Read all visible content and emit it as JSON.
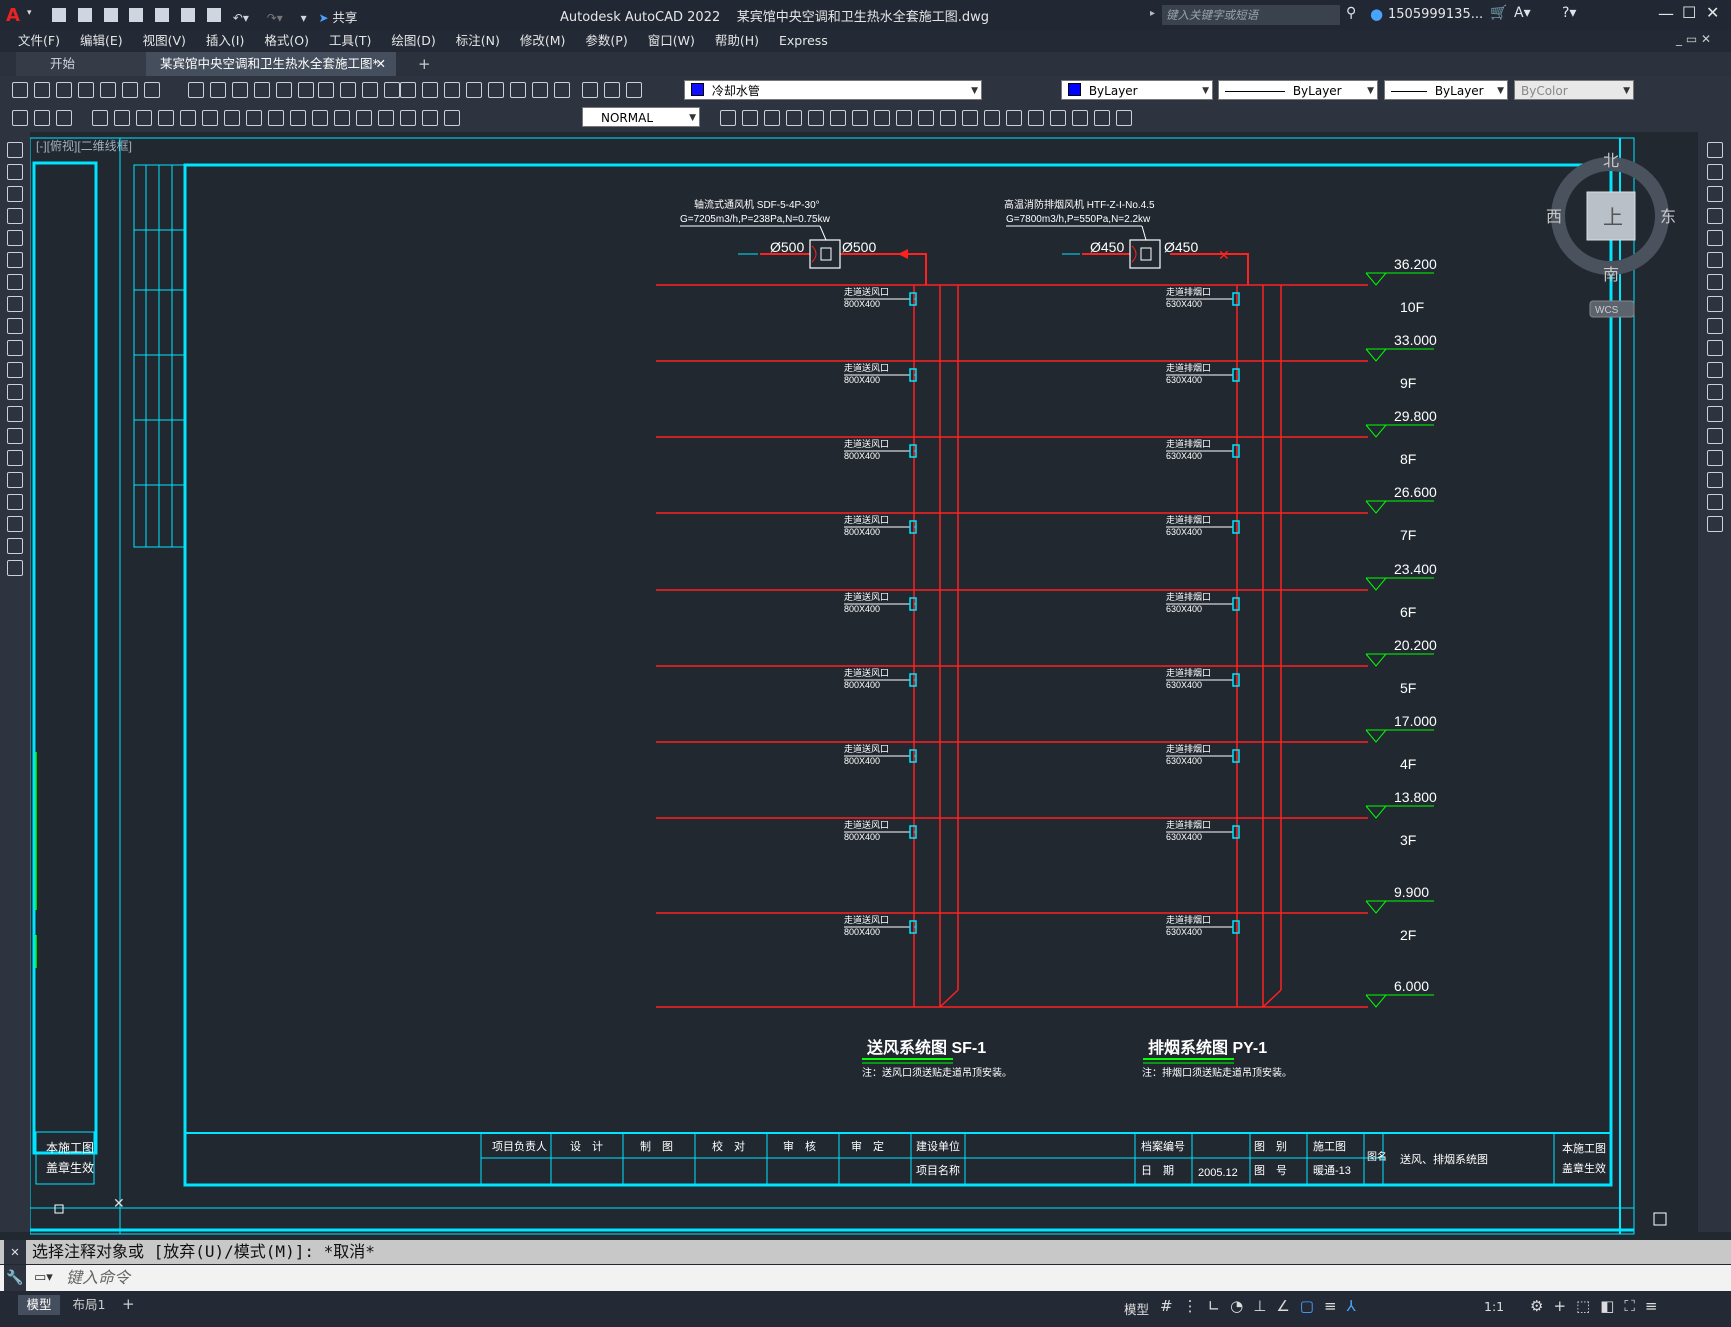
{
  "title": {
    "app": "Autodesk AutoCAD 2022",
    "file": "某宾馆中央空调和卫生热水全套施工图.dwg",
    "search_placeholder": "键入关键字或短语",
    "user": "1505999135...",
    "share": "共享"
  },
  "menu": [
    "文件(F)",
    "编辑(E)",
    "视图(V)",
    "插入(I)",
    "格式(O)",
    "工具(T)",
    "绘图(D)",
    "标注(N)",
    "修改(M)",
    "参数(P)",
    "窗口(W)",
    "帮助(H)",
    "Express"
  ],
  "tabs": {
    "start": "开始",
    "drawing": "某宾馆中央空调和卫生热水全套施工图*",
    "close": "✕",
    "add": "+"
  },
  "toolbar": {
    "layer_name": "冷却水管",
    "color": "ByLayer",
    "linetype": "ByLayer",
    "lineweight": "ByLayer",
    "plotstyle": "ByColor",
    "dimstyle": "NORMAL"
  },
  "viewport_label": "[-][俯视][二维线框]",
  "viewcube": {
    "n": "北",
    "s": "南",
    "e": "东",
    "w": "西",
    "top": "上",
    "wcs": "WCS"
  },
  "drawing": {
    "fan_left_label1": "轴流式通风机 SDF-5-4P-30°",
    "fan_left_label2": "G=7205m3/h,P=238Pa,N=0.75kw",
    "fan_right_label1": "高温消防排烟风机 HTF-Z-I-No.4.5",
    "fan_right_label2": "G=7800m3/h,P=550Pa,N=2.2kw",
    "duct_left_in": "Ø500",
    "duct_left_out": "Ø500",
    "duct_right_in": "Ø450",
    "duct_right_out": "Ø450",
    "supply_outlet_label": "走道送风口",
    "supply_outlet_size": "800X400",
    "exhaust_outlet_label": "走道排烟口",
    "exhaust_outlet_size": "630X400",
    "title_left": "送风系统图 SF-1",
    "title_right": "排烟系统图 PY-1",
    "note_left": "注：送风口须送贴走道吊顶安装。",
    "note_right": "注：排烟口须送贴走道吊顶安装。",
    "levels": [
      {
        "elev": "36.200",
        "floor": "10F"
      },
      {
        "elev": "33.000",
        "floor": "9F"
      },
      {
        "elev": "29.800",
        "floor": "8F"
      },
      {
        "elev": "26.600",
        "floor": "7F"
      },
      {
        "elev": "23.400",
        "floor": "6F"
      },
      {
        "elev": "20.200",
        "floor": "5F"
      },
      {
        "elev": "17.000",
        "floor": "4F"
      },
      {
        "elev": "13.800",
        "floor": "3F"
      },
      {
        "elev": "9.900",
        "floor": "2F"
      },
      {
        "elev": "6.000",
        "floor": ""
      }
    ],
    "titleblock": {
      "c1": "项目负责人",
      "c2": "设　计",
      "c3": "制　图",
      "c4": "校　对",
      "c5": "审　核",
      "c6": "审　定",
      "c7": "建设单位",
      "c8": "项目名称",
      "c9": "档案编号",
      "c10": "日　期",
      "c11": "2005.12",
      "c12": "图　别",
      "c13": "施工图",
      "c14": "图　号",
      "c15": "暖通-13",
      "c16": "图名",
      "c17": "送风、排烟系统图",
      "c18": "本施工图",
      "c19": "盖章生效"
    },
    "left_sheet_note1": "本施工图",
    "left_sheet_note2": "盖章生效"
  },
  "command": {
    "history": "选择注释对象或 [放弃(U)/模式(M)]: *取消*",
    "placeholder": "键入命令"
  },
  "status": {
    "model_tab": "模型",
    "layout_tab": "布局1",
    "add": "+",
    "model": "模型",
    "scale": "1:1"
  },
  "colors": {
    "cyan": "#00ffff",
    "red": "#ff0000",
    "green": "#00ff00",
    "bg": "#212830",
    "white": "#ffffff"
  }
}
